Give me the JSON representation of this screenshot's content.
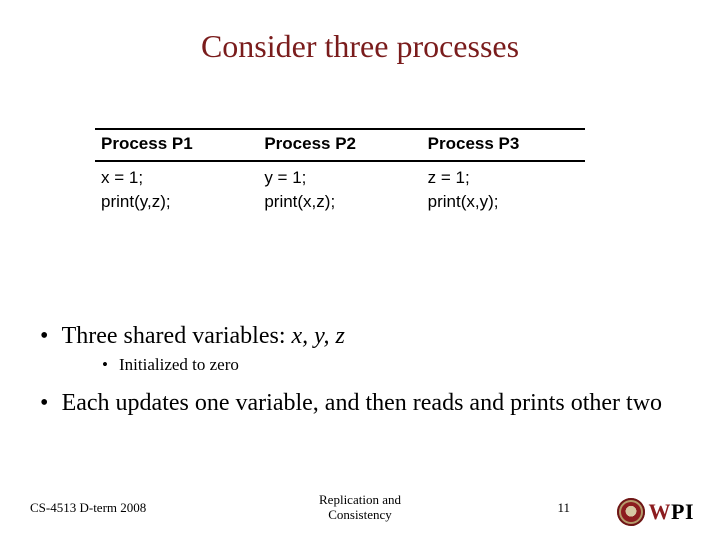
{
  "title": "Consider three processes",
  "table": {
    "headers": [
      "Process P1",
      "Process P2",
      "Process P3"
    ],
    "rows": [
      [
        "x = 1;",
        "y = 1;",
        "z = 1;"
      ],
      [
        "print(y,z);",
        "print(x,z);",
        "print(x,y);"
      ]
    ]
  },
  "bullets": {
    "b1_text": "Three shared variables: ",
    "b1_vars": "x, y, z",
    "b1_sub": "Initialized to zero",
    "b2_text": "Each updates one variable, and then reads and prints other two"
  },
  "footer": {
    "left": "CS-4513 D-term 2008",
    "center_line1": "Replication and",
    "center_line2": "Consistency",
    "page": "11",
    "logo_text": "WPI"
  }
}
